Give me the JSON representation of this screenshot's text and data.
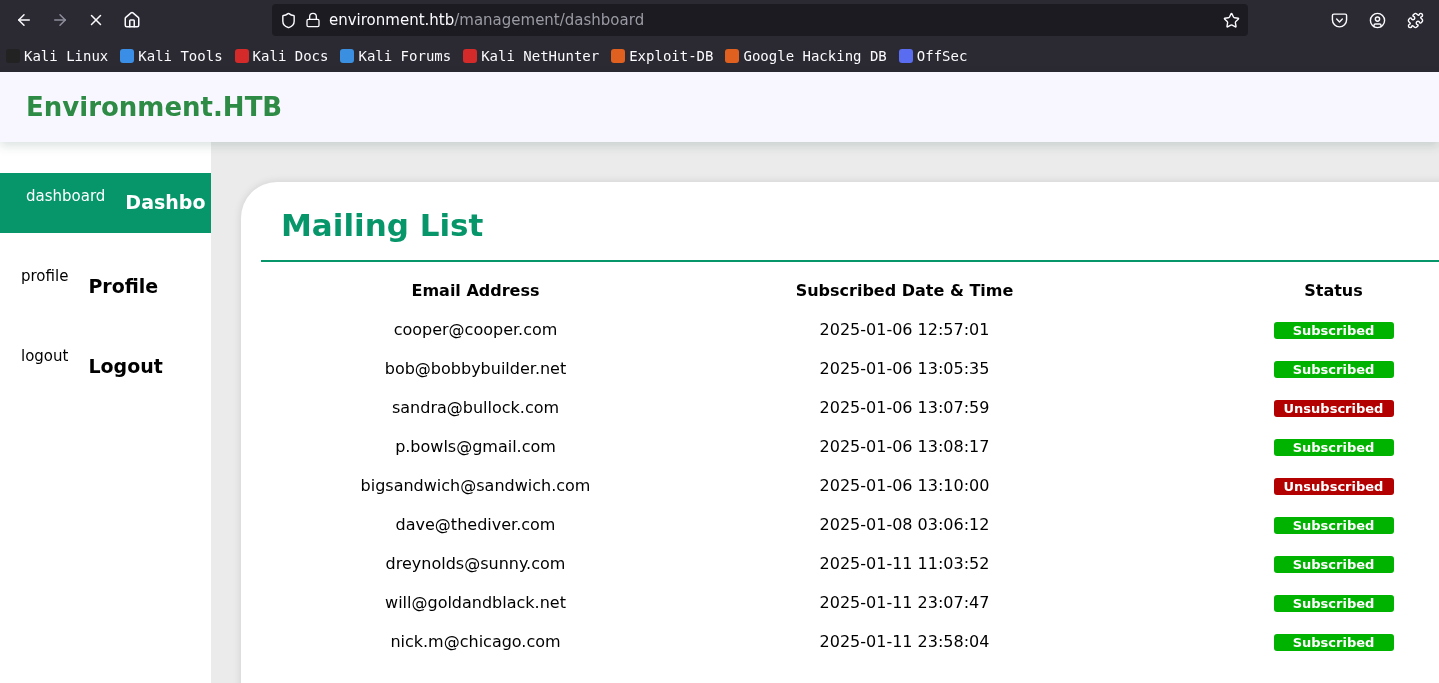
{
  "browser": {
    "url_host": "environment.htb",
    "url_path": "/management/dashboard",
    "bookmarks": [
      {
        "label": "Kali Linux",
        "color": "#222222"
      },
      {
        "label": "Kali Tools",
        "color": "#3a8ee6"
      },
      {
        "label": "Kali Docs",
        "color": "#d42a2a"
      },
      {
        "label": "Kali Forums",
        "color": "#3b8fe0"
      },
      {
        "label": "Kali NetHunter",
        "color": "#d42a2a"
      },
      {
        "label": "Exploit-DB",
        "color": "#e0601f"
      },
      {
        "label": "Google Hacking DB",
        "color": "#e0601f"
      },
      {
        "label": "OffSec",
        "color": "#5a6cf0"
      }
    ]
  },
  "header": {
    "title": "Environment.HTB"
  },
  "sidebar": {
    "items": [
      {
        "icon_text": "dashboard",
        "label": "Dashbo",
        "selected": true
      },
      {
        "icon_text": "profile",
        "label": "Profile",
        "selected": false
      },
      {
        "icon_text": "logout",
        "label": "Logout",
        "selected": false
      }
    ]
  },
  "card": {
    "title": "Mailing List"
  },
  "table": {
    "columns": [
      "Email Address",
      "Subscribed Date & Time",
      "Status"
    ],
    "rows": [
      {
        "email": "cooper@cooper.com",
        "date": "2025-01-06 12:57:01",
        "status": "Subscribed",
        "subscribed": true
      },
      {
        "email": "bob@bobbybuilder.net",
        "date": "2025-01-06 13:05:35",
        "status": "Subscribed",
        "subscribed": true
      },
      {
        "email": "sandra@bullock.com",
        "date": "2025-01-06 13:07:59",
        "status": "Unsubscribed",
        "subscribed": false
      },
      {
        "email": "p.bowls@gmail.com",
        "date": "2025-01-06 13:08:17",
        "status": "Subscribed",
        "subscribed": true
      },
      {
        "email": "bigsandwich@sandwich.com",
        "date": "2025-01-06 13:10:00",
        "status": "Unsubscribed",
        "subscribed": false
      },
      {
        "email": "dave@thediver.com",
        "date": "2025-01-08 03:06:12",
        "status": "Subscribed",
        "subscribed": true
      },
      {
        "email": "dreynolds@sunny.com",
        "date": "2025-01-11 11:03:52",
        "status": "Subscribed",
        "subscribed": true
      },
      {
        "email": "will@goldandblack.net",
        "date": "2025-01-11 23:07:47",
        "status": "Subscribed",
        "subscribed": true
      },
      {
        "email": "nick.m@chicago.com",
        "date": "2025-01-11 23:58:04",
        "status": "Subscribed",
        "subscribed": true
      }
    ]
  }
}
